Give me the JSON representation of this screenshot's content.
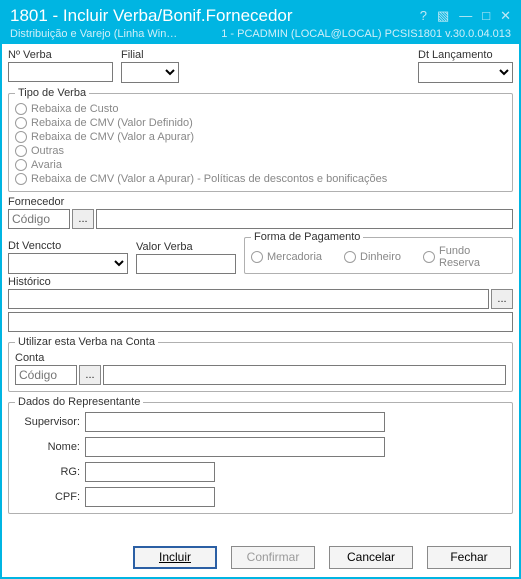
{
  "titlebar": {
    "title": "1801 - Incluir Verba/Bonif.Fornecedor",
    "help": "?",
    "edit": "▧",
    "min": "—",
    "max": "□",
    "close": "✕"
  },
  "subbar": {
    "left": "Distribuição e Varejo (Linha Win…",
    "right": "1 - PCADMIN (LOCAL@LOCAL)   PCSIS1801   v.30.0.04.013"
  },
  "top": {
    "nverba_label": "Nº Verba",
    "nverba_value": "",
    "filial_label": "Filial",
    "dtlanc_label": "Dt Lançamento"
  },
  "tipoverba": {
    "legend": "Tipo de Verba",
    "opts": [
      "Rebaixa de Custo",
      "Rebaixa de CMV (Valor Definido)",
      "Rebaixa de CMV (Valor a Apurar)",
      "Outras",
      "Avaria",
      "Rebaixa de CMV (Valor a Apurar) - Políticas de descontos e bonificações"
    ]
  },
  "forn": {
    "label": "Fornecedor",
    "codigo_ph": "Código",
    "ell": "..."
  },
  "mid": {
    "dtvencto_label": "Dt Venccto",
    "valor_label": "Valor Verba",
    "forma_legend": "Forma de Pagamento",
    "forma_opts": [
      "Mercadoria",
      "Dinheiro",
      "Fundo Reserva"
    ]
  },
  "hist": {
    "label": "Histórico",
    "ell": "..."
  },
  "conta": {
    "legend": "Utilizar esta Verba na Conta",
    "label": "Conta",
    "codigo_ph": "Código",
    "ell": "..."
  },
  "rep": {
    "legend": "Dados do Representante",
    "supervisor": "Supervisor:",
    "nome": "Nome:",
    "rg": "RG:",
    "cpf": "CPF:"
  },
  "buttons": {
    "incluir": "Incluir",
    "confirmar": "Confirmar",
    "cancelar": "Cancelar",
    "fechar": "Fechar"
  }
}
